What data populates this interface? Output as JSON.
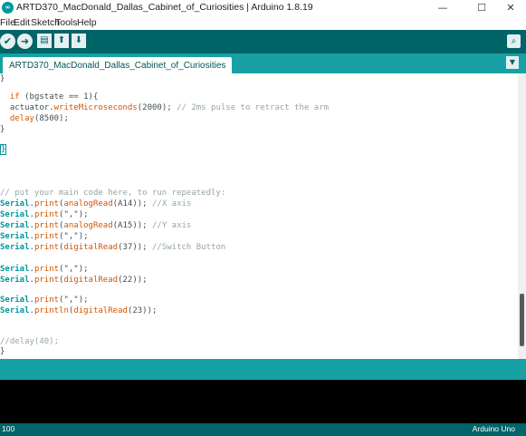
{
  "window": {
    "icon_label": "∞",
    "title": "ARTD370_MacDonald_Dallas_Cabinet_of_Curiosities | Arduino 1.8.19",
    "minimize": "—",
    "maximize": "☐",
    "close": "✕"
  },
  "menu": {
    "items": [
      "File",
      "Edit",
      "Sketch",
      "Tools",
      "Help"
    ]
  },
  "toolbar": {
    "verify_icon": "✔",
    "upload_icon": "➜",
    "new_icon": "▤",
    "open_icon": "⬆",
    "save_icon": "⬇",
    "serial_icon": "⌕"
  },
  "tabs": {
    "active": "ARTD370_MacDonald_Dallas_Cabinet_of_Curiosities",
    "menu_icon": "▼"
  },
  "code": {
    "l1": "}",
    "l3_indent": "  ",
    "l3_kw": "if",
    "l3_rest": " (bgstate == 1){",
    "l4_a": "  actuator.",
    "l4_fn": "writeMicroseconds",
    "l4_b": "(2000); ",
    "l4_cmt": "// 2ms pulse to retract the arm",
    "l5_indent": "  ",
    "l5_fn": "delay",
    "l5_rest": "(8500);",
    "l6": "}",
    "l8": "}",
    "l12": "// put your main code here, to run repeatedly:",
    "serial": "Serial",
    "dot": ".",
    "print": "print",
    "println": "println",
    "analogRead": "analogRead",
    "digitalRead": "digitalRead",
    "l13_rest1": "(",
    "l13_rest2": "(A14)); ",
    "l13_cmt": "//X axis",
    "l14_rest": "(\",\");",
    "l15_rest2": "(A15)); ",
    "l15_cmt": "//Y axis",
    "l16_rest": "(\",\");",
    "l17_rest2": "(37)); ",
    "l17_cmt": "//Switch Button",
    "l19_rest": "(\",\");",
    "l20_rest2": "(22));",
    "l22_rest": "(\",\");",
    "l23_rest2": "(23));",
    "l26": "//delay(40);",
    "l27": "}"
  },
  "status": {
    "line": "100",
    "board": "Arduino Uno"
  }
}
